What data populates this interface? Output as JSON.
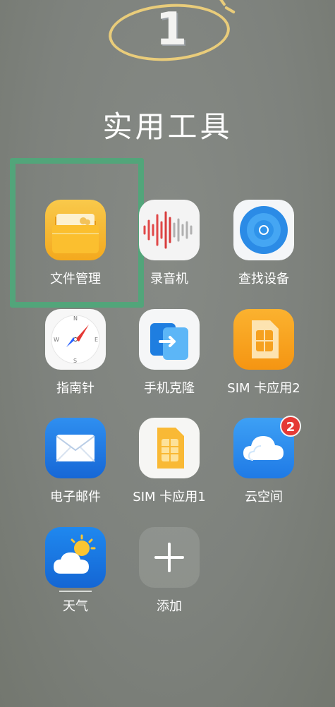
{
  "annotation": {
    "step_number": "1"
  },
  "folder": {
    "title": "实用工具"
  },
  "apps": [
    {
      "id": "file-manager",
      "label": "文件管理",
      "icon": "folder-icon"
    },
    {
      "id": "recorder",
      "label": "录音机",
      "icon": "soundwave-icon"
    },
    {
      "id": "find-device",
      "label": "查找设备",
      "icon": "radar-icon"
    },
    {
      "id": "compass",
      "label": "指南针",
      "icon": "compass-icon"
    },
    {
      "id": "phone-clone",
      "label": "手机克隆",
      "icon": "phone-clone-icon"
    },
    {
      "id": "sim-app-2",
      "label": "SIM 卡应用2",
      "icon": "sim-card-icon"
    },
    {
      "id": "email",
      "label": "电子邮件",
      "icon": "envelope-icon"
    },
    {
      "id": "sim-app-1",
      "label": "SIM 卡应用1",
      "icon": "sim-card-icon"
    },
    {
      "id": "cloud",
      "label": "云空间",
      "icon": "cloud-icon",
      "badge": "2"
    },
    {
      "id": "weather",
      "label": "天气",
      "icon": "weather-icon"
    },
    {
      "id": "add",
      "label": "添加",
      "icon": "plus-icon"
    }
  ],
  "colors": {
    "highlight": "#52a57a",
    "annotation": "#e9cc7a",
    "badge": "#e53935"
  }
}
